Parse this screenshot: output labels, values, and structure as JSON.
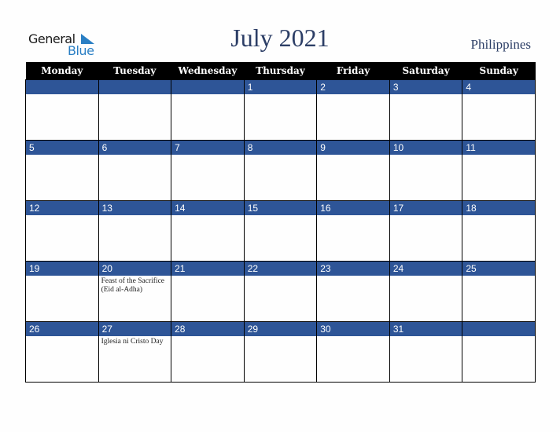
{
  "brand": {
    "line1": "General",
    "line2": "Blue"
  },
  "title": "July 2021",
  "country": "Philippines",
  "weekdays": [
    "Monday",
    "Tuesday",
    "Wednesday",
    "Thursday",
    "Friday",
    "Saturday",
    "Sunday"
  ],
  "weeks": [
    [
      {
        "day": "",
        "event": ""
      },
      {
        "day": "",
        "event": ""
      },
      {
        "day": "",
        "event": ""
      },
      {
        "day": "1",
        "event": ""
      },
      {
        "day": "2",
        "event": ""
      },
      {
        "day": "3",
        "event": ""
      },
      {
        "day": "4",
        "event": ""
      }
    ],
    [
      {
        "day": "5",
        "event": ""
      },
      {
        "day": "6",
        "event": ""
      },
      {
        "day": "7",
        "event": ""
      },
      {
        "day": "8",
        "event": ""
      },
      {
        "day": "9",
        "event": ""
      },
      {
        "day": "10",
        "event": ""
      },
      {
        "day": "11",
        "event": ""
      }
    ],
    [
      {
        "day": "12",
        "event": ""
      },
      {
        "day": "13",
        "event": ""
      },
      {
        "day": "14",
        "event": ""
      },
      {
        "day": "15",
        "event": ""
      },
      {
        "day": "16",
        "event": ""
      },
      {
        "day": "17",
        "event": ""
      },
      {
        "day": "18",
        "event": ""
      }
    ],
    [
      {
        "day": "19",
        "event": ""
      },
      {
        "day": "20",
        "event": "Feast of the Sacrifice (Eid al-Adha)"
      },
      {
        "day": "21",
        "event": ""
      },
      {
        "day": "22",
        "event": ""
      },
      {
        "day": "23",
        "event": ""
      },
      {
        "day": "24",
        "event": ""
      },
      {
        "day": "25",
        "event": ""
      }
    ],
    [
      {
        "day": "26",
        "event": ""
      },
      {
        "day": "27",
        "event": "Iglesia ni Cristo Day"
      },
      {
        "day": "28",
        "event": ""
      },
      {
        "day": "29",
        "event": ""
      },
      {
        "day": "30",
        "event": ""
      },
      {
        "day": "31",
        "event": ""
      },
      {
        "day": "",
        "event": ""
      }
    ]
  ],
  "colors": {
    "header_bg": "#000000",
    "band_bg": "#2e5597",
    "title": "#2c3e66",
    "logo_blue": "#2a7fc4"
  }
}
